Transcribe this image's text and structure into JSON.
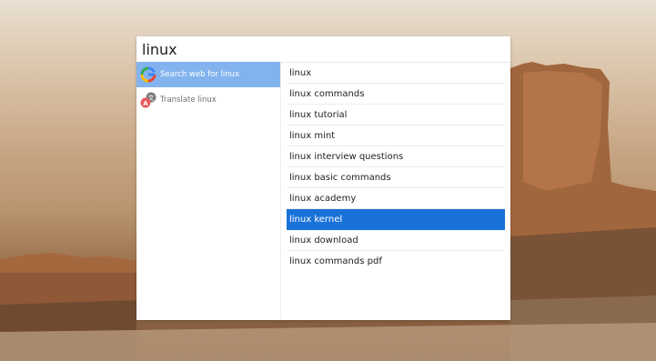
{
  "search": {
    "query": "linux"
  },
  "actions": [
    {
      "label": "Search web for linux",
      "icon": "google-icon",
      "selected": true
    },
    {
      "label": "Translate linux",
      "icon": "translate-icon",
      "selected": false
    }
  ],
  "suggestions": [
    {
      "label": "linux"
    },
    {
      "label": "linux commands"
    },
    {
      "label": "linux tutorial"
    },
    {
      "label": "linux mint"
    },
    {
      "label": "linux interview questions"
    },
    {
      "label": "linux basic commands"
    },
    {
      "label": "linux academy"
    },
    {
      "label": "linux kernel"
    },
    {
      "label": "linux download"
    },
    {
      "label": "linux commands pdf"
    }
  ],
  "selected_suggestion_index": 7,
  "colors": {
    "action_selected_bg": "#83b3ee",
    "suggestion_selected_bg": "#1a72d9"
  }
}
